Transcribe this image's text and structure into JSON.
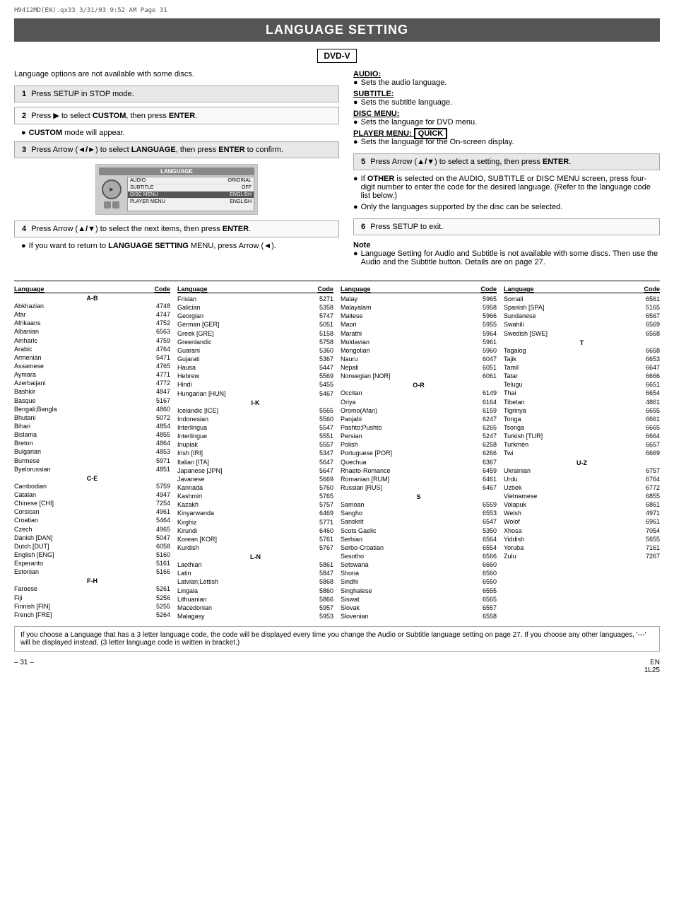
{
  "header": {
    "file_info": "H9412MD(EN).qx33   3/31/03  9:52 AM   Page 31"
  },
  "title": "LANGUAGE SETTING",
  "dvd_badge": "DVD-V",
  "intro": "Language options are not available with some discs.",
  "steps": [
    {
      "num": "1",
      "text": "Press SETUP in STOP mode.",
      "shaded": true
    },
    {
      "num": "2",
      "text": "Press ▶ to select CUSTOM, then press ENTER.",
      "shaded": false
    },
    {
      "bullet": "CUSTOM mode will appear.",
      "bold": "CUSTOM"
    },
    {
      "num": "3",
      "text": "Press Arrow (◄/►) to select LANGUAGE, then press ENTER to confirm.",
      "shaded": true
    },
    {
      "num": "4",
      "text": "Press Arrow (▲/▼) to select the next items, then press ENTER.",
      "shaded": false
    },
    {
      "bullet": "If you want to return to LANGUAGE SETTING MENU, press Arrow (◄).",
      "bold": "LANGUAGE SETTING"
    }
  ],
  "right_sections": {
    "audio": {
      "label": "AUDIO:",
      "bullet": "Sets the audio language."
    },
    "subtitle": {
      "label": "SUBTITLE:",
      "bullet": "Sets the subtitle language."
    },
    "disc_menu": {
      "label": "DISC MENU:",
      "bullet": "Sets the language for DVD menu."
    },
    "player_menu": {
      "label": "PLAYER MENU:",
      "badge": "QUICK",
      "bullet": "Sets the language for the On-screen display."
    },
    "step5": {
      "num": "5",
      "text": "Press Arrow (▲/▼) to select a setting, then press ENTER.",
      "shaded": true
    },
    "bullet_other": "If OTHER is selected on the AUDIO, SUBTITLE or DISC MENU screen, press four-digit number to enter the code for the desired language. (Refer to the language code list below.)",
    "bold_other": "OTHER",
    "bullet_only": "Only the languages supported by the disc can be selected.",
    "step6": {
      "num": "6",
      "text": "Press SETUP to exit."
    },
    "note_label": "Note",
    "note_text": "Language Setting for Audio and Subtitle is not available with some discs. Then use the Audio and the Subtitle button. Details are on page 27."
  },
  "device_menu": {
    "label": "LANGUAGE",
    "rows": [
      {
        "left": "AUDIO",
        "right": "ORIGINAL",
        "highlighted": false
      },
      {
        "left": "SUBTITLE",
        "right": "OFF",
        "highlighted": false
      },
      {
        "left": "DISC MENU",
        "right": "ENGLISH",
        "highlighted": true
      },
      {
        "left": "PLAYER MENU",
        "right": "ENGLISH",
        "highlighted": false
      }
    ]
  },
  "lang_table": {
    "col1": {
      "header_lang": "Language",
      "header_code": "Code",
      "section_ab": "A-B",
      "rows": [
        {
          "name": "Abkhazian",
          "code": "4748"
        },
        {
          "name": "Afar",
          "code": "4747"
        },
        {
          "name": "Afrikaans",
          "code": "4752"
        },
        {
          "name": "Albanian",
          "code": "6563"
        },
        {
          "name": "Amharic",
          "code": "4759"
        },
        {
          "name": "Arabic",
          "code": "4764"
        },
        {
          "name": "Armenian",
          "code": "5471"
        },
        {
          "name": "Assamese",
          "code": "4765"
        },
        {
          "name": "Aymara",
          "code": "4771"
        },
        {
          "name": "Azerbaijani",
          "code": "4772"
        },
        {
          "name": "Bashkir",
          "code": "4847"
        },
        {
          "name": "Basque",
          "code": "5167"
        },
        {
          "name": "Bengali;Bangla",
          "code": "4860"
        },
        {
          "name": "Bhutani",
          "code": "5072"
        },
        {
          "name": "Bihari",
          "code": "4854"
        },
        {
          "name": "Bislama",
          "code": "4855"
        },
        {
          "name": "Breton",
          "code": "4864"
        },
        {
          "name": "Bulgarian",
          "code": "4853"
        },
        {
          "name": "Burmese",
          "code": "5971"
        },
        {
          "name": "Byelorussian",
          "code": "4851"
        },
        {
          "name": "",
          "code": ""
        },
        {
          "name": "",
          "code": ""
        },
        {
          "name": "",
          "code": ""
        },
        {
          "name": "section_ce",
          "code": ""
        },
        {
          "name": "Cambodian",
          "code": "5759"
        },
        {
          "name": "Catalan",
          "code": "4947"
        },
        {
          "name": "Chinese [CHI]",
          "code": "7254"
        },
        {
          "name": "Corsican",
          "code": "4961"
        },
        {
          "name": "Croatian",
          "code": "5464"
        },
        {
          "name": "Czech",
          "code": "4965"
        },
        {
          "name": "Danish [DAN]",
          "code": "5047"
        },
        {
          "name": "Dutch [DUT]",
          "code": "6058"
        },
        {
          "name": "English [ENG]",
          "code": "5160"
        },
        {
          "name": "Esperanto",
          "code": "5161"
        },
        {
          "name": "Estonian",
          "code": "5166"
        },
        {
          "name": "",
          "code": ""
        },
        {
          "name": "section_fh",
          "code": ""
        },
        {
          "name": "Faroese",
          "code": "5261"
        },
        {
          "name": "Fiji",
          "code": "5256"
        },
        {
          "name": "Finnish [FIN]",
          "code": "5255"
        },
        {
          "name": "French [FRE]",
          "code": "5264"
        }
      ]
    },
    "col2": {
      "header_lang": "Language",
      "header_code": "Code",
      "rows": [
        {
          "name": "Frisian",
          "code": "5271"
        },
        {
          "name": "Galician",
          "code": "5358"
        },
        {
          "name": "Georgian",
          "code": "5747"
        },
        {
          "name": "German [GER]",
          "code": "5051"
        },
        {
          "name": "Greek [GRE]",
          "code": "5158"
        },
        {
          "name": "Greenlandic",
          "code": "5758"
        },
        {
          "name": "Guarani",
          "code": "5360"
        },
        {
          "name": "Gujarati",
          "code": "5367"
        },
        {
          "name": "Hausa",
          "code": "5447"
        },
        {
          "name": "Hebrew",
          "code": "5569"
        },
        {
          "name": "Hindi",
          "code": "5455"
        },
        {
          "name": "Hungarian [HUN]",
          "code": "5467"
        },
        {
          "name": "",
          "code": ""
        },
        {
          "name": "section_ik",
          "code": ""
        },
        {
          "name": "Icelandic [ICE]",
          "code": "5565"
        },
        {
          "name": "Indonesian",
          "code": "5560"
        },
        {
          "name": "Interlingua",
          "code": "5547"
        },
        {
          "name": "Interlingue",
          "code": "5551"
        },
        {
          "name": "Inupiak",
          "code": "5557"
        },
        {
          "name": "Irish [IRI]",
          "code": "5347"
        },
        {
          "name": "Italian [ITA]",
          "code": "5647"
        },
        {
          "name": "Japanese [JPN]",
          "code": "5647"
        },
        {
          "name": "Javanese",
          "code": "5669"
        },
        {
          "name": "Kannada",
          "code": "5760"
        },
        {
          "name": "Kashmiri",
          "code": "5765"
        },
        {
          "name": "Kazakh",
          "code": "5757"
        },
        {
          "name": "Kinyarwanda",
          "code": "6469"
        },
        {
          "name": "Kirghiz",
          "code": "5771"
        },
        {
          "name": "Kirundi",
          "code": "6460"
        },
        {
          "name": "Korean [KOR]",
          "code": "5761"
        },
        {
          "name": "Kurdish",
          "code": "5767"
        },
        {
          "name": "",
          "code": ""
        },
        {
          "name": "section_ln",
          "code": ""
        },
        {
          "name": "Laothian",
          "code": "5861"
        },
        {
          "name": "Latin",
          "code": "5847"
        },
        {
          "name": "Latvian;Lettish",
          "code": "5868"
        },
        {
          "name": "Lingala",
          "code": "5860"
        },
        {
          "name": "Lithuanian",
          "code": "5866"
        },
        {
          "name": "Macedonian",
          "code": "5957"
        },
        {
          "name": "Malagasy",
          "code": "5953"
        }
      ]
    },
    "col3": {
      "header_lang": "Language",
      "header_code": "Code",
      "rows": [
        {
          "name": "Malay",
          "code": "5965"
        },
        {
          "name": "Malayalam",
          "code": "5958"
        },
        {
          "name": "Maltese",
          "code": "5966"
        },
        {
          "name": "Maori",
          "code": "5955"
        },
        {
          "name": "Marathi",
          "code": "5964"
        },
        {
          "name": "Moldavian",
          "code": "5961"
        },
        {
          "name": "Mongolian",
          "code": "5960"
        },
        {
          "name": "Nauru",
          "code": "6047"
        },
        {
          "name": "Nepali",
          "code": "6051"
        },
        {
          "name": "Norwegian [NOR]",
          "code": "6061"
        },
        {
          "name": "",
          "code": ""
        },
        {
          "name": "section_or",
          "code": ""
        },
        {
          "name": "Occitan",
          "code": "6149"
        },
        {
          "name": "Oriya",
          "code": "6164"
        },
        {
          "name": "Oromo(Afan)",
          "code": "6159"
        },
        {
          "name": "Panjabi",
          "code": "6247"
        },
        {
          "name": "Pashto;Pushto",
          "code": "6265"
        },
        {
          "name": "Persian",
          "code": "5247"
        },
        {
          "name": "Polish",
          "code": "6258"
        },
        {
          "name": "Portuguese [POR]",
          "code": "6266"
        },
        {
          "name": "Quechua",
          "code": "6367"
        },
        {
          "name": "Rhaeto-Romance",
          "code": "6459"
        },
        {
          "name": "Romanian [RUM]",
          "code": "6461"
        },
        {
          "name": "Russian [RUS]",
          "code": "6467"
        },
        {
          "name": "",
          "code": ""
        },
        {
          "name": "section_s",
          "code": ""
        },
        {
          "name": "Samoan",
          "code": "6559"
        },
        {
          "name": "Sangho",
          "code": "6553"
        },
        {
          "name": "Sanskrit",
          "code": "6547"
        },
        {
          "name": "Scots Gaelic",
          "code": "5350"
        },
        {
          "name": "Serbian",
          "code": "6564"
        },
        {
          "name": "Serbo-Croatian",
          "code": "6554"
        },
        {
          "name": "Sesotho",
          "code": "6566"
        },
        {
          "name": "Setswana",
          "code": "6660"
        },
        {
          "name": "Shona",
          "code": "6560"
        },
        {
          "name": "Sindhi",
          "code": "6550"
        },
        {
          "name": "Singhalese",
          "code": "6555"
        },
        {
          "name": "Siswat",
          "code": "6565"
        },
        {
          "name": "Slovak",
          "code": "6557"
        },
        {
          "name": "Slovenian",
          "code": "6558"
        }
      ]
    },
    "col4": {
      "header_lang": "Language",
      "header_code": "Code",
      "rows": [
        {
          "name": "Somali",
          "code": "6561"
        },
        {
          "name": "Spanish [SPA]",
          "code": "5165"
        },
        {
          "name": "Sundanese",
          "code": "6567"
        },
        {
          "name": "Swahili",
          "code": "6569"
        },
        {
          "name": "Swedish [SWE]",
          "code": "6568"
        },
        {
          "name": "",
          "code": ""
        },
        {
          "name": "section_t",
          "code": ""
        },
        {
          "name": "Tagalog",
          "code": "6658"
        },
        {
          "name": "Tajik",
          "code": "6653"
        },
        {
          "name": "Tamil",
          "code": "6647"
        },
        {
          "name": "Tatar",
          "code": "6666"
        },
        {
          "name": "Telugu",
          "code": "6651"
        },
        {
          "name": "Thai",
          "code": "6654"
        },
        {
          "name": "Tibetan",
          "code": "4861"
        },
        {
          "name": "Tigrinya",
          "code": "6655"
        },
        {
          "name": "Tonga",
          "code": "6661"
        },
        {
          "name": "Tsonga",
          "code": "6665"
        },
        {
          "name": "Turkish [TUR]",
          "code": "6664"
        },
        {
          "name": "Turkmen",
          "code": "6657"
        },
        {
          "name": "Twi",
          "code": "6669"
        },
        {
          "name": "",
          "code": ""
        },
        {
          "name": "section_uz",
          "code": ""
        },
        {
          "name": "Ukrainian",
          "code": "6757"
        },
        {
          "name": "Urdu",
          "code": "6764"
        },
        {
          "name": "Uzbek",
          "code": "6772"
        },
        {
          "name": "Vietnamese",
          "code": "6855"
        },
        {
          "name": "Volapuk",
          "code": "6861"
        },
        {
          "name": "Welsh",
          "code": "4971"
        },
        {
          "name": "Wolof",
          "code": "6961"
        },
        {
          "name": "Xhosa",
          "code": "7054"
        },
        {
          "name": "Yiddish",
          "code": "5655"
        },
        {
          "name": "Yoruba",
          "code": "7161"
        },
        {
          "name": "Zulu",
          "code": "7267"
        }
      ]
    }
  },
  "footer_note": "If you choose a Language that has a 3 letter language code, the code will be displayed every time you change the Audio or Subtitle language setting on page 27. If you choose any other languages, '---' will be displayed instead. (3 letter language code is written in bracket.)",
  "page_footer": {
    "left": "– 31 –",
    "right": "EN\n1L25"
  }
}
